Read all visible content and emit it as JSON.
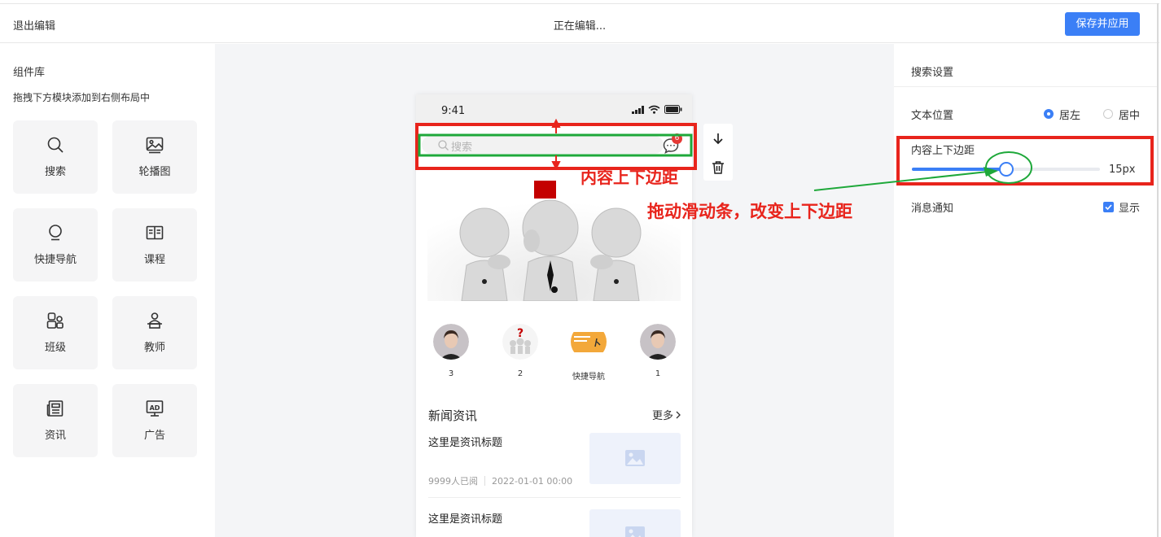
{
  "topbar": {
    "exit_label": "退出编辑",
    "status": "正在编辑...",
    "save_label": "保存并应用"
  },
  "library": {
    "title": "组件库",
    "subtitle": "拖拽下方模块添加到右侧布局中",
    "items": [
      {
        "label": "搜索",
        "icon": "search-icon"
      },
      {
        "label": "轮播图",
        "icon": "image-carousel-icon"
      },
      {
        "label": "快捷导航",
        "icon": "bulb-icon"
      },
      {
        "label": "课程",
        "icon": "book-icon"
      },
      {
        "label": "班级",
        "icon": "class-group-icon"
      },
      {
        "label": "教师",
        "icon": "teacher-icon"
      },
      {
        "label": "资讯",
        "icon": "newspaper-icon"
      },
      {
        "label": "广告",
        "icon": "ad-icon"
      }
    ]
  },
  "phone": {
    "time": "9:41",
    "search_placeholder": "搜索",
    "message_badge": "6",
    "quick_nav": [
      {
        "label": "3",
        "icon": "avatar-woman"
      },
      {
        "label": "2",
        "icon": "question-people"
      },
      {
        "label": "快捷导航",
        "icon": "yellow-card"
      },
      {
        "label": "1",
        "icon": "avatar-woman"
      }
    ],
    "news": {
      "title": "新闻资讯",
      "more": "更多",
      "articles": [
        {
          "title": "这里是资讯标题",
          "reads": "9999人已阅",
          "date": "2022-01-01 00:00"
        },
        {
          "title": "这里是资讯标题"
        }
      ]
    }
  },
  "settings": {
    "title": "搜索设置",
    "text_position": {
      "label": "文本位置",
      "options": [
        "居左",
        "居中"
      ],
      "selected": "居左"
    },
    "padding": {
      "label": "内容上下边距",
      "value_label": "15px",
      "fraction": 0.5
    },
    "notification": {
      "label": "消息通知",
      "option": "显示",
      "checked": true
    }
  },
  "annotations": {
    "phone_note": "内容上下边距",
    "slider_note": "拖动滑动条，改变上下边距"
  },
  "colors": {
    "accent": "#3b7ff6",
    "annotation_red": "#e8241c",
    "annotation_green": "#1ea83a"
  }
}
